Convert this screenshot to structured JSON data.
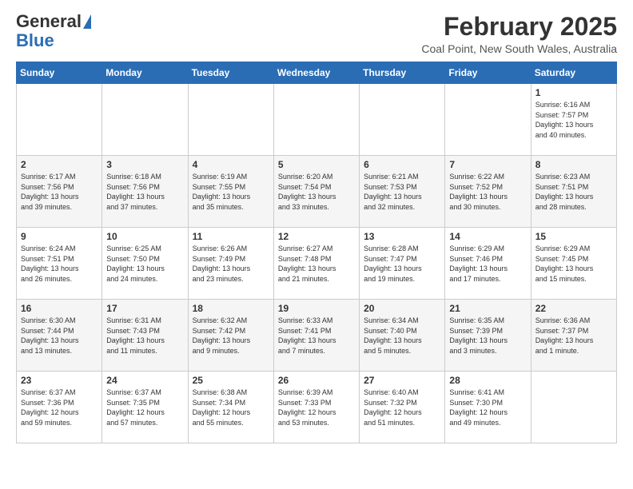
{
  "header": {
    "logo_general": "General",
    "logo_blue": "Blue",
    "month_year": "February 2025",
    "location": "Coal Point, New South Wales, Australia"
  },
  "weekdays": [
    "Sunday",
    "Monday",
    "Tuesday",
    "Wednesday",
    "Thursday",
    "Friday",
    "Saturday"
  ],
  "weeks": [
    [
      {
        "day": "",
        "detail": ""
      },
      {
        "day": "",
        "detail": ""
      },
      {
        "day": "",
        "detail": ""
      },
      {
        "day": "",
        "detail": ""
      },
      {
        "day": "",
        "detail": ""
      },
      {
        "day": "",
        "detail": ""
      },
      {
        "day": "1",
        "detail": "Sunrise: 6:16 AM\nSunset: 7:57 PM\nDaylight: 13 hours\nand 40 minutes."
      }
    ],
    [
      {
        "day": "2",
        "detail": "Sunrise: 6:17 AM\nSunset: 7:56 PM\nDaylight: 13 hours\nand 39 minutes."
      },
      {
        "day": "3",
        "detail": "Sunrise: 6:18 AM\nSunset: 7:56 PM\nDaylight: 13 hours\nand 37 minutes."
      },
      {
        "day": "4",
        "detail": "Sunrise: 6:19 AM\nSunset: 7:55 PM\nDaylight: 13 hours\nand 35 minutes."
      },
      {
        "day": "5",
        "detail": "Sunrise: 6:20 AM\nSunset: 7:54 PM\nDaylight: 13 hours\nand 33 minutes."
      },
      {
        "day": "6",
        "detail": "Sunrise: 6:21 AM\nSunset: 7:53 PM\nDaylight: 13 hours\nand 32 minutes."
      },
      {
        "day": "7",
        "detail": "Sunrise: 6:22 AM\nSunset: 7:52 PM\nDaylight: 13 hours\nand 30 minutes."
      },
      {
        "day": "8",
        "detail": "Sunrise: 6:23 AM\nSunset: 7:51 PM\nDaylight: 13 hours\nand 28 minutes."
      }
    ],
    [
      {
        "day": "9",
        "detail": "Sunrise: 6:24 AM\nSunset: 7:51 PM\nDaylight: 13 hours\nand 26 minutes."
      },
      {
        "day": "10",
        "detail": "Sunrise: 6:25 AM\nSunset: 7:50 PM\nDaylight: 13 hours\nand 24 minutes."
      },
      {
        "day": "11",
        "detail": "Sunrise: 6:26 AM\nSunset: 7:49 PM\nDaylight: 13 hours\nand 23 minutes."
      },
      {
        "day": "12",
        "detail": "Sunrise: 6:27 AM\nSunset: 7:48 PM\nDaylight: 13 hours\nand 21 minutes."
      },
      {
        "day": "13",
        "detail": "Sunrise: 6:28 AM\nSunset: 7:47 PM\nDaylight: 13 hours\nand 19 minutes."
      },
      {
        "day": "14",
        "detail": "Sunrise: 6:29 AM\nSunset: 7:46 PM\nDaylight: 13 hours\nand 17 minutes."
      },
      {
        "day": "15",
        "detail": "Sunrise: 6:29 AM\nSunset: 7:45 PM\nDaylight: 13 hours\nand 15 minutes."
      }
    ],
    [
      {
        "day": "16",
        "detail": "Sunrise: 6:30 AM\nSunset: 7:44 PM\nDaylight: 13 hours\nand 13 minutes."
      },
      {
        "day": "17",
        "detail": "Sunrise: 6:31 AM\nSunset: 7:43 PM\nDaylight: 13 hours\nand 11 minutes."
      },
      {
        "day": "18",
        "detail": "Sunrise: 6:32 AM\nSunset: 7:42 PM\nDaylight: 13 hours\nand 9 minutes."
      },
      {
        "day": "19",
        "detail": "Sunrise: 6:33 AM\nSunset: 7:41 PM\nDaylight: 13 hours\nand 7 minutes."
      },
      {
        "day": "20",
        "detail": "Sunrise: 6:34 AM\nSunset: 7:40 PM\nDaylight: 13 hours\nand 5 minutes."
      },
      {
        "day": "21",
        "detail": "Sunrise: 6:35 AM\nSunset: 7:39 PM\nDaylight: 13 hours\nand 3 minutes."
      },
      {
        "day": "22",
        "detail": "Sunrise: 6:36 AM\nSunset: 7:37 PM\nDaylight: 13 hours\nand 1 minute."
      }
    ],
    [
      {
        "day": "23",
        "detail": "Sunrise: 6:37 AM\nSunset: 7:36 PM\nDaylight: 12 hours\nand 59 minutes."
      },
      {
        "day": "24",
        "detail": "Sunrise: 6:37 AM\nSunset: 7:35 PM\nDaylight: 12 hours\nand 57 minutes."
      },
      {
        "day": "25",
        "detail": "Sunrise: 6:38 AM\nSunset: 7:34 PM\nDaylight: 12 hours\nand 55 minutes."
      },
      {
        "day": "26",
        "detail": "Sunrise: 6:39 AM\nSunset: 7:33 PM\nDaylight: 12 hours\nand 53 minutes."
      },
      {
        "day": "27",
        "detail": "Sunrise: 6:40 AM\nSunset: 7:32 PM\nDaylight: 12 hours\nand 51 minutes."
      },
      {
        "day": "28",
        "detail": "Sunrise: 6:41 AM\nSunset: 7:30 PM\nDaylight: 12 hours\nand 49 minutes."
      },
      {
        "day": "",
        "detail": ""
      }
    ]
  ]
}
